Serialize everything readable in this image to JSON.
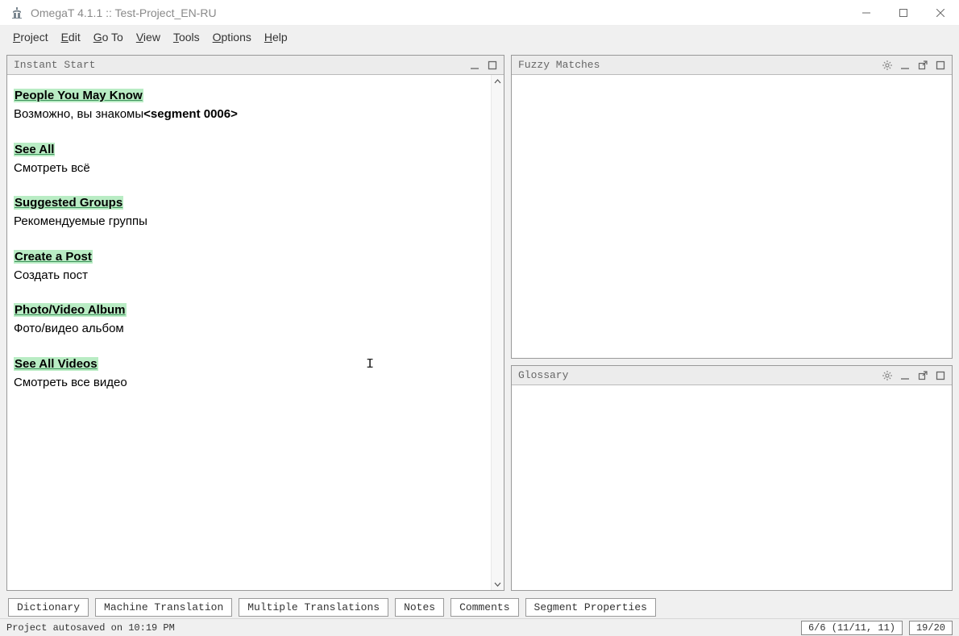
{
  "titlebar": {
    "title": "OmegaT 4.1.1 :: Test-Project_EN-RU"
  },
  "menu": {
    "project": "Project",
    "edit": "Edit",
    "goto": "Go To",
    "view": "View",
    "tools": "Tools",
    "options": "Options",
    "help": "Help"
  },
  "panes": {
    "editor_title": "Instant Start",
    "fuzzy_title": "Fuzzy Matches",
    "glossary_title": "Glossary"
  },
  "segments": [
    {
      "source": "People You May Know",
      "target_prefix": "Возможно, вы знакомы",
      "tag": "<segment 0006>"
    },
    {
      "source": "See All",
      "target": "Смотреть всё"
    },
    {
      "source": "Suggested Groups",
      "target": "Рекомендуемые группы"
    },
    {
      "source": "Create a Post",
      "target": "Создать пост"
    },
    {
      "source": "Photo/Video Album",
      "target": "Фото/видео альбом"
    },
    {
      "source": "See All Videos",
      "target": "Смотреть все видео"
    }
  ],
  "tabs": {
    "dictionary": "Dictionary",
    "mt": "Machine Translation",
    "multi": "Multiple Translations",
    "notes": "Notes",
    "comments": "Comments",
    "segprops": "Segment Properties"
  },
  "status": {
    "message": "Project autosaved on 10:19 PM",
    "counter1": "6/6 (11/11, 11)",
    "counter2": "19/20"
  }
}
